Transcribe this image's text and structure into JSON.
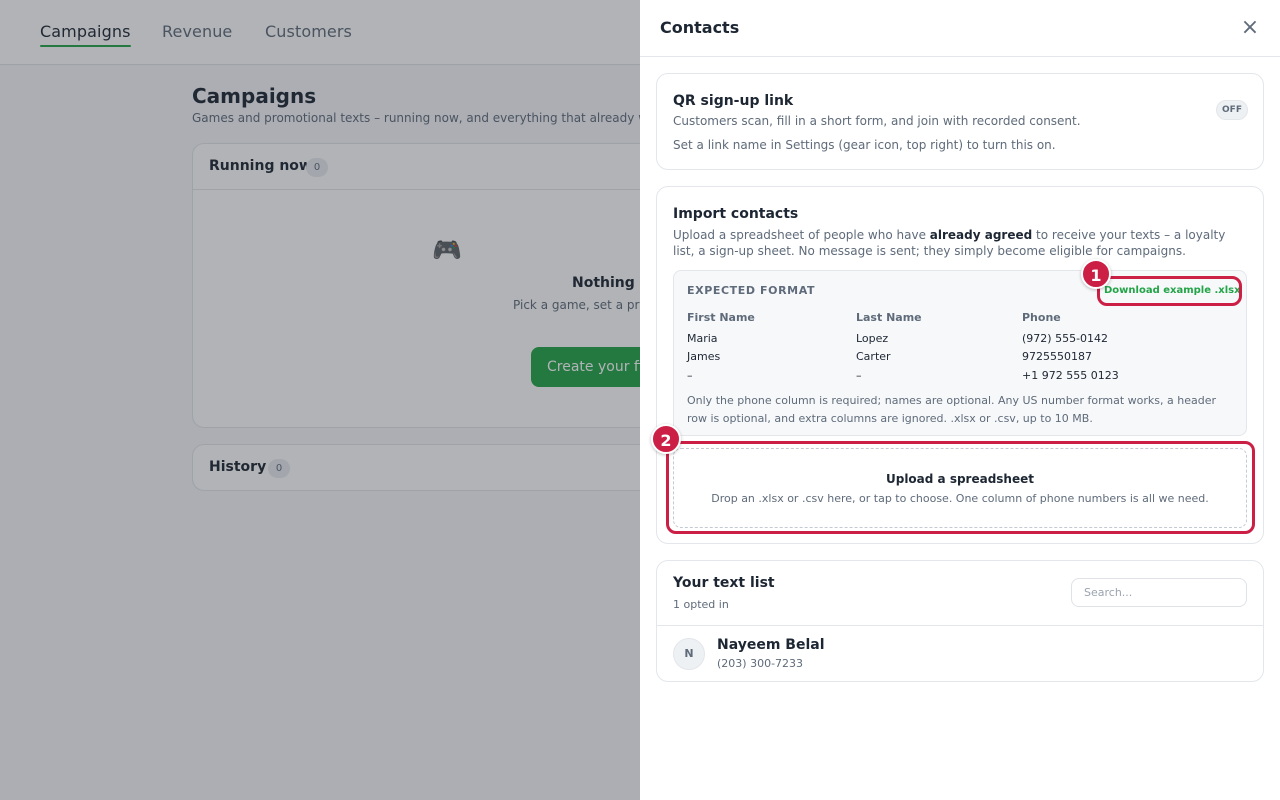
{
  "nav": {
    "tabs": [
      {
        "label": "Campaigns",
        "active": true
      },
      {
        "label": "Revenue",
        "active": false
      },
      {
        "label": "Customers",
        "active": false
      }
    ]
  },
  "main": {
    "title": "Campaigns",
    "subtitle": "Games and promotional texts – running now, and everything that already we",
    "running": {
      "title": "Running now",
      "count": "0"
    },
    "empty": {
      "icon": "gamepad-icon",
      "title": "Nothing ru",
      "desc": "Pick a game, set a prize, test it o takes it fr",
      "button": "Create your fi"
    },
    "history": {
      "title": "History",
      "count": "0"
    }
  },
  "drawer": {
    "title": "Contacts",
    "close_icon": "close-icon",
    "qr": {
      "title": "QR sign-up link",
      "desc": "Customers scan, fill in a short form, and join with recorded consent.",
      "hint": "Set a link name in Settings (gear icon, top right) to turn this on.",
      "toggle": "OFF"
    },
    "import": {
      "title": "Import contacts",
      "desc_pre": "Upload a spreadsheet of people who have ",
      "desc_bold": "already agreed",
      "desc_post": " to receive your texts – a loyalty list, a sign-up sheet. No message is sent; they simply become eligible for campaigns.",
      "format_label": "EXPECTED FORMAT",
      "download_link": "Download example .xlsx",
      "columns": [
        "First Name",
        "Last Name",
        "Phone"
      ],
      "rows": [
        [
          "Maria",
          "Lopez",
          "(972) 555-0142"
        ],
        [
          "James",
          "Carter",
          "9725550187"
        ],
        [
          "–",
          "–",
          "+1 972 555 0123"
        ]
      ],
      "note": "Only the phone column is required; names are optional. Any US number format works, a header row is optional, and extra columns are ignored. .xlsx or .csv, up to 10 MB.",
      "upload_title": "Upload a spreadsheet",
      "upload_desc": "Drop an .xlsx or .csv here, or tap to choose. One column of phone numbers is all we need."
    },
    "list": {
      "title": "Your text list",
      "subtitle": "1 opted in",
      "search_placeholder": "Search...",
      "contacts": [
        {
          "initial": "N",
          "name": "Nayeem Belal",
          "phone": "(203) 300-7233"
        }
      ]
    }
  },
  "callouts": [
    {
      "number": "1",
      "color": "#cc1f45"
    },
    {
      "number": "2",
      "color": "#cc1f45"
    }
  ],
  "colors": {
    "accent": "#22a447",
    "callout": "#cc1f45",
    "text": "#1d2633",
    "muted": "#5f6b7a"
  }
}
